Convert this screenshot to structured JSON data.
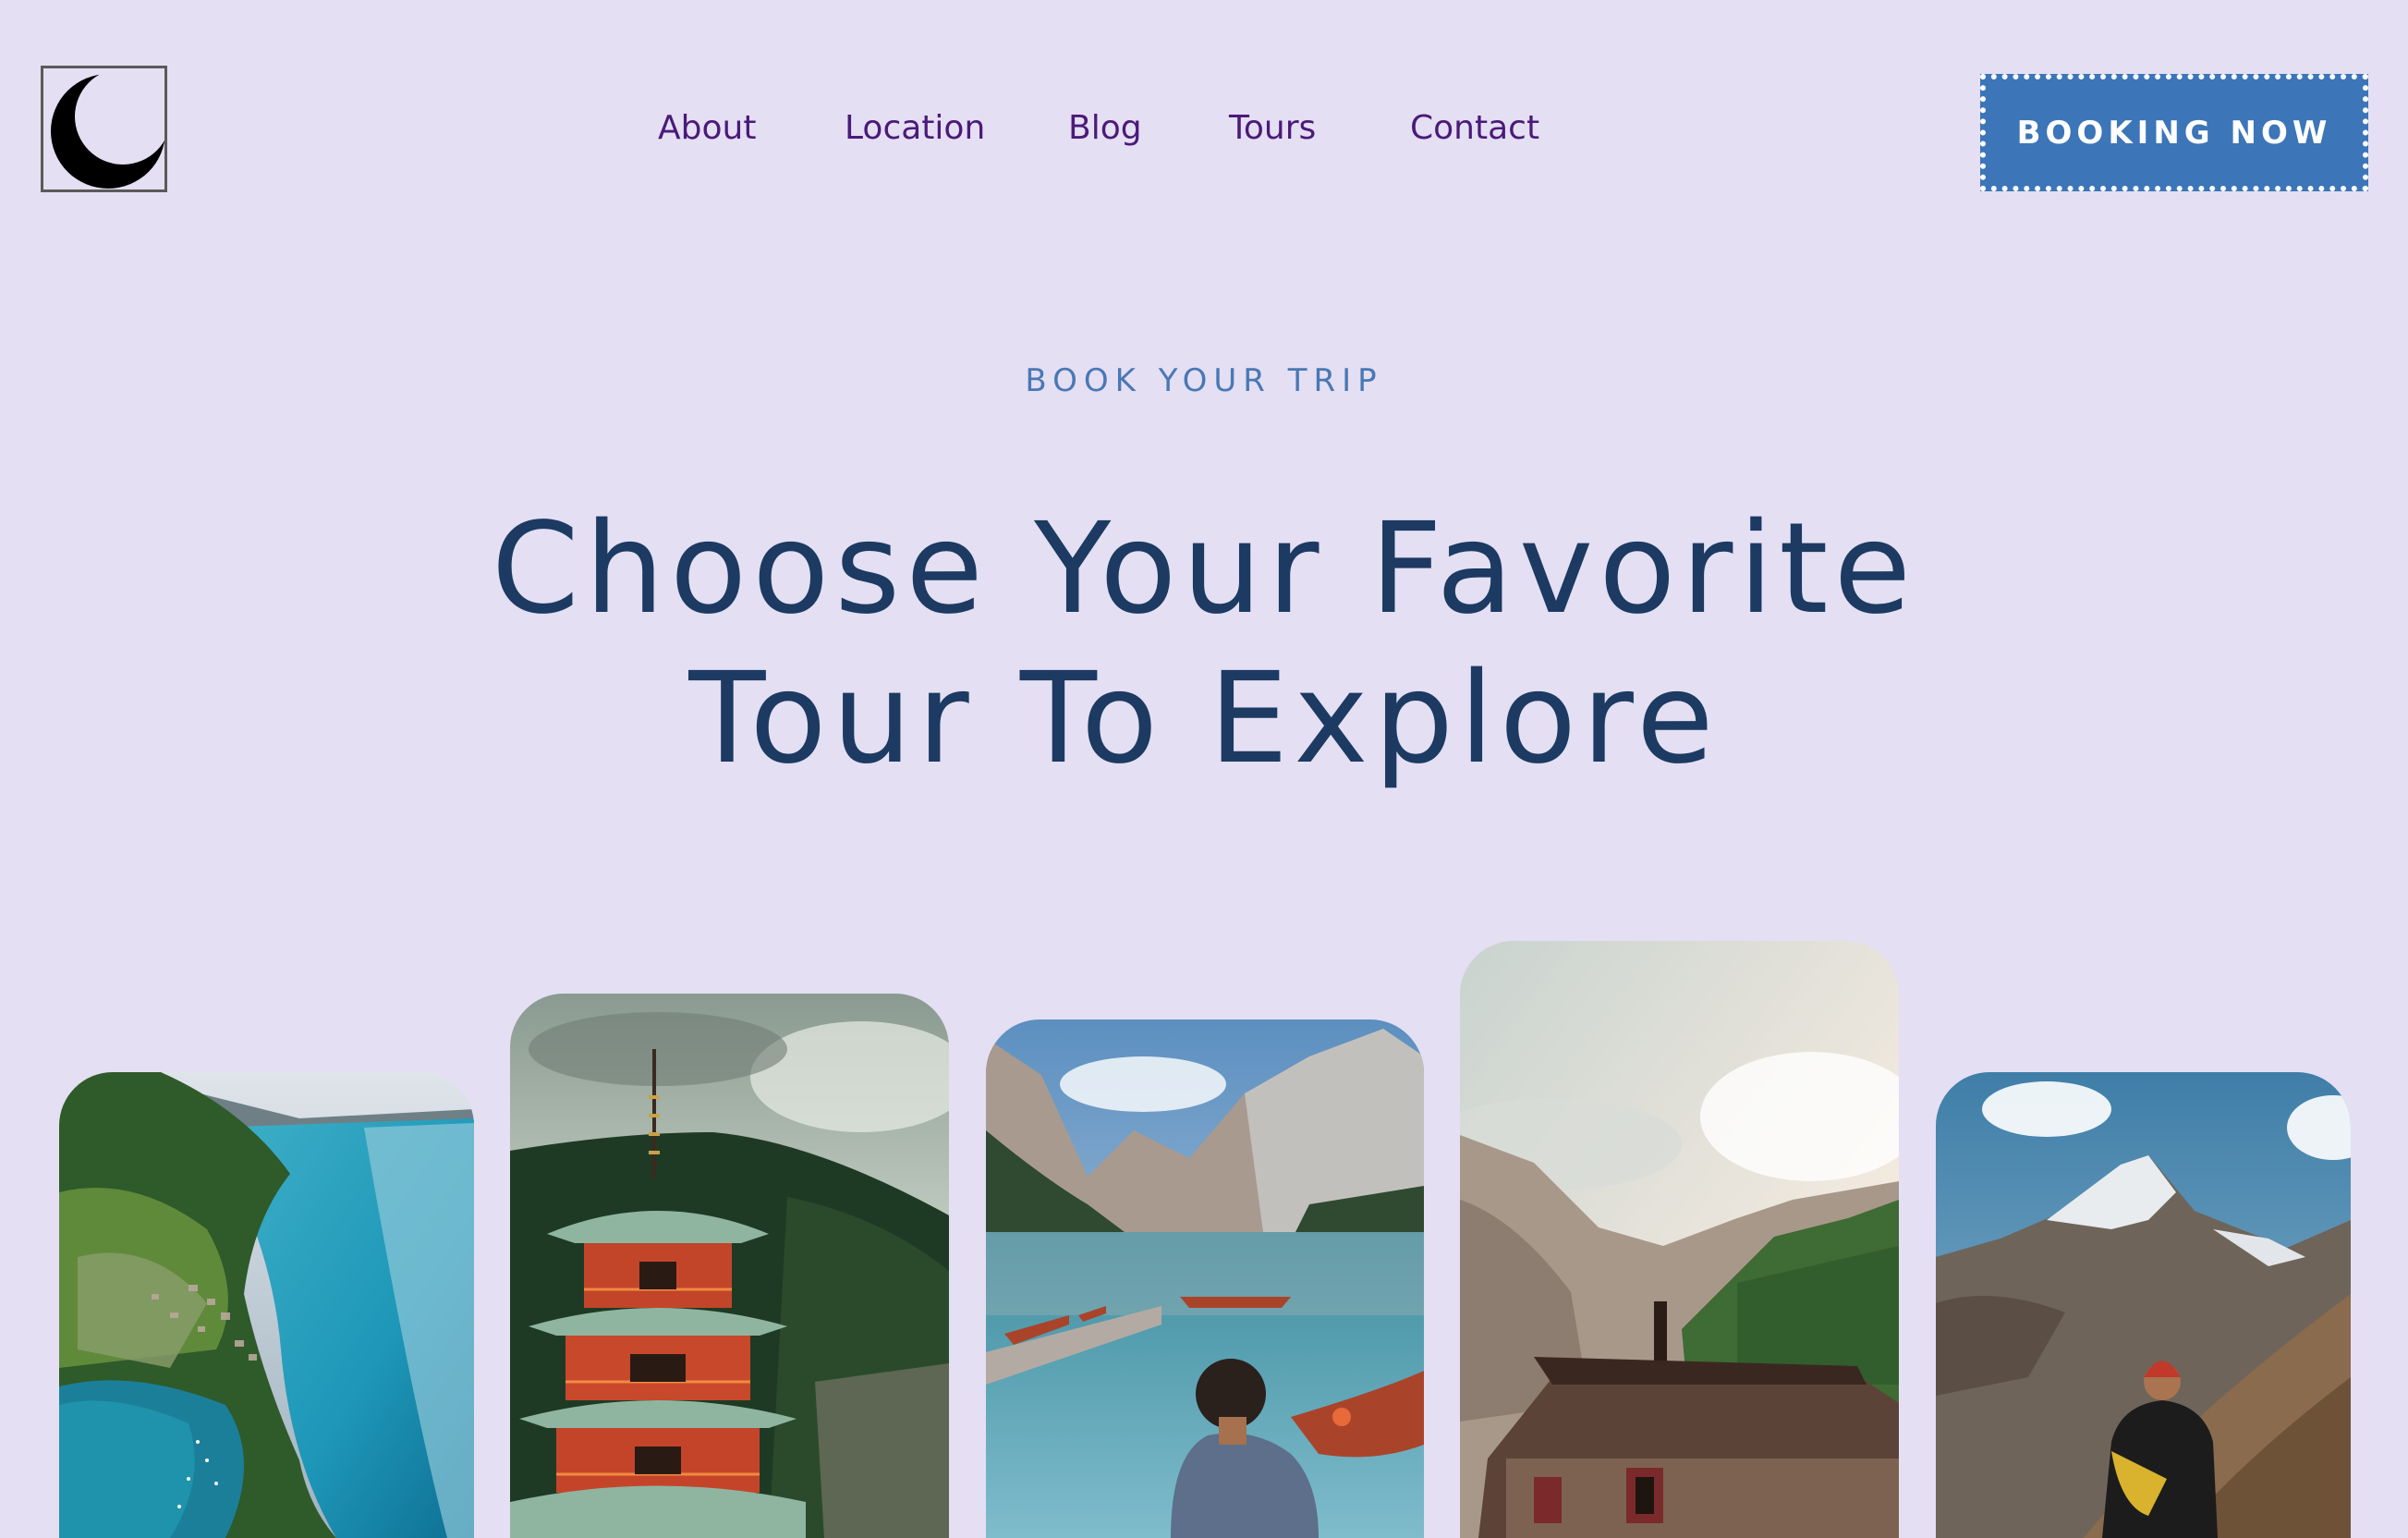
{
  "header": {
    "logo_icon": "crescent-moon-icon",
    "nav": [
      "About",
      "Location",
      "Blog",
      "Tours",
      "Contact"
    ],
    "booking_label": "BOOKING NOW"
  },
  "hero": {
    "eyebrow": "BOOK YOUR TRIP",
    "title_line1": "Choose Your Favorite",
    "title_line2": "Tour To Explore"
  },
  "tours": [
    {
      "image": "aerial-lake-village-photo"
    },
    {
      "image": "red-pagoda-photo"
    },
    {
      "image": "mountain-lake-boats-photo"
    },
    {
      "image": "alpine-cabin-photo"
    },
    {
      "image": "snowy-mountain-hiker-photo"
    }
  ],
  "colors": {
    "background": "#e4dff3",
    "nav_text": "#4b1a78",
    "button_bg": "#3c75b8",
    "title": "#1c3a62",
    "eyebrow": "#4a78b4"
  }
}
